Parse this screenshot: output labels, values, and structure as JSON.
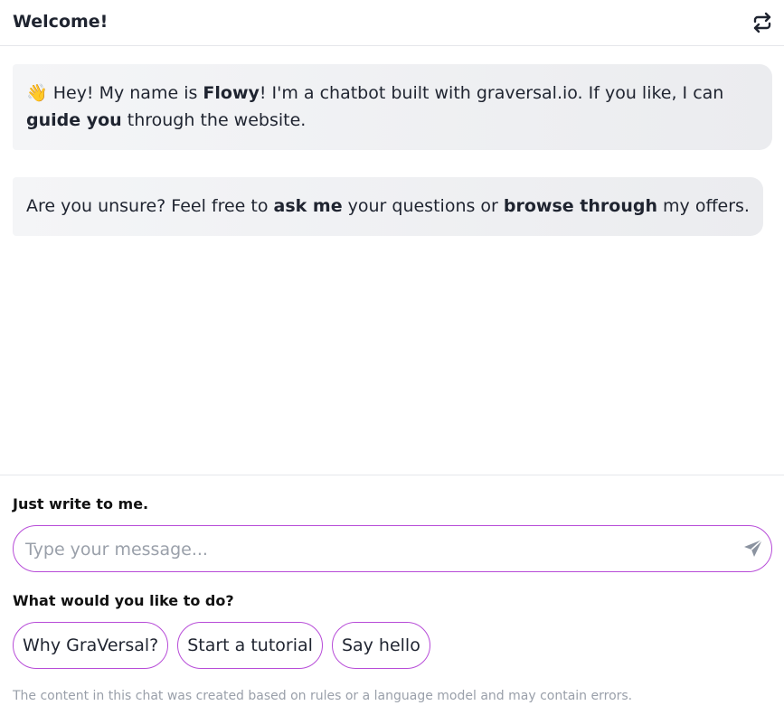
{
  "header": {
    "title": "Welcome!",
    "reset_icon": "refresh-arrows-icon"
  },
  "messages": [
    {
      "emoji": "👋",
      "parts": [
        {
          "text": " Hey! My name is ",
          "bold": false
        },
        {
          "text": "Flowy",
          "bold": true
        },
        {
          "text": "! I'm a chatbot built with graversal.io. If you like, I can ",
          "bold": false
        },
        {
          "text": "guide you",
          "bold": true
        },
        {
          "text": " through the website.",
          "bold": false
        }
      ]
    },
    {
      "parts": [
        {
          "text": "Are you unsure? Feel free to ",
          "bold": false
        },
        {
          "text": "ask me",
          "bold": true
        },
        {
          "text": " your questions or ",
          "bold": false
        },
        {
          "text": "browse through",
          "bold": true
        },
        {
          "text": " my offers.",
          "bold": false
        }
      ]
    }
  ],
  "composer": {
    "label": "Just write to me.",
    "placeholder": "Type your message...",
    "value": "",
    "send_icon": "paper-plane-icon"
  },
  "quick_actions": {
    "label": "What would you like to do?",
    "items": [
      "Why GraVersal?",
      "Start a tutorial",
      "Say hello"
    ]
  },
  "disclaimer": "The content in this chat was created based on rules or a language model and may contain errors.",
  "colors": {
    "accent_border": "#b74cd8",
    "bubble_bg": "#eef0f2",
    "muted_text": "#9aa0aa"
  }
}
